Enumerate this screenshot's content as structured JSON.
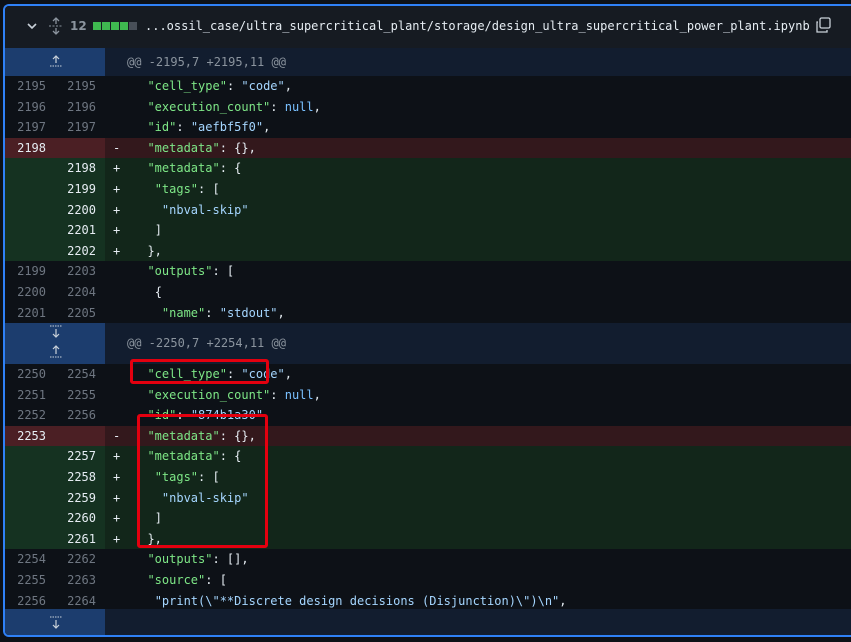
{
  "header": {
    "changes_count": "12",
    "diffstat": [
      "add",
      "add",
      "add",
      "add",
      "neutral"
    ],
    "file_path": "...ossil_case/ultra_supercritical_plant/storage/design_ultra_supercritical_power_plant.ipynb",
    "colors": {
      "add": "#3fb950",
      "neutral": "#484f58"
    }
  },
  "hunks": [
    {
      "header": "@@ -2195,7 +2195,11 @@"
    },
    {
      "header": "@@ -2250,7 +2254,11 @@"
    }
  ],
  "block1": [
    {
      "type": "ctx",
      "old": "2195",
      "new": "2195",
      "marker": "",
      "tokens": [
        [
          "k",
          "\"cell_type\""
        ],
        [
          "p",
          ": "
        ],
        [
          "s",
          "\"code\""
        ],
        [
          "p",
          ","
        ]
      ],
      "indent": "  "
    },
    {
      "type": "ctx",
      "old": "2196",
      "new": "2196",
      "marker": "",
      "tokens": [
        [
          "k",
          "\"execution_count\""
        ],
        [
          "p",
          ": "
        ],
        [
          "nl",
          "null"
        ],
        [
          "p",
          ","
        ]
      ],
      "indent": "  "
    },
    {
      "type": "ctx",
      "old": "2197",
      "new": "2197",
      "marker": "",
      "tokens": [
        [
          "k",
          "\"id\""
        ],
        [
          "p",
          ": "
        ],
        [
          "s",
          "\"aefbf5f0\""
        ],
        [
          "p",
          ","
        ]
      ],
      "indent": "  "
    },
    {
      "type": "del",
      "old": "2198",
      "new": "",
      "marker": "-",
      "tokens": [
        [
          "k",
          "\"metadata\""
        ],
        [
          "p",
          ": {},"
        ]
      ],
      "indent": "  "
    },
    {
      "type": "add",
      "old": "",
      "new": "2198",
      "marker": "+",
      "tokens": [
        [
          "k",
          "\"metadata\""
        ],
        [
          "p",
          ": {"
        ]
      ],
      "indent": "  "
    },
    {
      "type": "add",
      "old": "",
      "new": "2199",
      "marker": "+",
      "tokens": [
        [
          "k",
          "\"tags\""
        ],
        [
          "p",
          ": ["
        ]
      ],
      "indent": "   "
    },
    {
      "type": "add",
      "old": "",
      "new": "2200",
      "marker": "+",
      "tokens": [
        [
          "s",
          "\"nbval-skip\""
        ]
      ],
      "indent": "    "
    },
    {
      "type": "add",
      "old": "",
      "new": "2201",
      "marker": "+",
      "tokens": [
        [
          "p",
          "]"
        ]
      ],
      "indent": "   "
    },
    {
      "type": "add",
      "old": "",
      "new": "2202",
      "marker": "+",
      "tokens": [
        [
          "p",
          "},"
        ]
      ],
      "indent": "  "
    },
    {
      "type": "ctx",
      "old": "2199",
      "new": "2203",
      "marker": "",
      "tokens": [
        [
          "k",
          "\"outputs\""
        ],
        [
          "p",
          ": ["
        ]
      ],
      "indent": "  "
    },
    {
      "type": "ctx",
      "old": "2200",
      "new": "2204",
      "marker": "",
      "tokens": [
        [
          "p",
          "{"
        ]
      ],
      "indent": "   "
    },
    {
      "type": "ctx",
      "old": "2201",
      "new": "2205",
      "marker": "",
      "tokens": [
        [
          "k",
          "\"name\""
        ],
        [
          "p",
          ": "
        ],
        [
          "s",
          "\"stdout\""
        ],
        [
          "p",
          ","
        ]
      ],
      "indent": "    "
    }
  ],
  "block2": [
    {
      "type": "ctx",
      "old": "2250",
      "new": "2254",
      "marker": "",
      "tokens": [
        [
          "k",
          "\"cell_type\""
        ],
        [
          "p",
          ": "
        ],
        [
          "s",
          "\"code\""
        ],
        [
          "p",
          ","
        ]
      ],
      "indent": "  "
    },
    {
      "type": "ctx",
      "old": "2251",
      "new": "2255",
      "marker": "",
      "tokens": [
        [
          "k",
          "\"execution_count\""
        ],
        [
          "p",
          ": "
        ],
        [
          "nl",
          "null"
        ],
        [
          "p",
          ","
        ]
      ],
      "indent": "  "
    },
    {
      "type": "ctx",
      "old": "2252",
      "new": "2256",
      "marker": "",
      "tokens": [
        [
          "k",
          "\"id\""
        ],
        [
          "p",
          ": "
        ],
        [
          "s",
          "\"874b1a30\""
        ],
        [
          "p",
          ","
        ]
      ],
      "indent": "  "
    },
    {
      "type": "del",
      "old": "2253",
      "new": "",
      "marker": "-",
      "tokens": [
        [
          "k",
          "\"metadata\""
        ],
        [
          "p",
          ": {},"
        ]
      ],
      "indent": "  "
    },
    {
      "type": "add",
      "old": "",
      "new": "2257",
      "marker": "+",
      "tokens": [
        [
          "k",
          "\"metadata\""
        ],
        [
          "p",
          ": {"
        ]
      ],
      "indent": "  "
    },
    {
      "type": "add",
      "old": "",
      "new": "2258",
      "marker": "+",
      "tokens": [
        [
          "k",
          "\"tags\""
        ],
        [
          "p",
          ": ["
        ]
      ],
      "indent": "   "
    },
    {
      "type": "add",
      "old": "",
      "new": "2259",
      "marker": "+",
      "tokens": [
        [
          "s",
          "\"nbval-skip\""
        ]
      ],
      "indent": "    "
    },
    {
      "type": "add",
      "old": "",
      "new": "2260",
      "marker": "+",
      "tokens": [
        [
          "p",
          "]"
        ]
      ],
      "indent": "   "
    },
    {
      "type": "add",
      "old": "",
      "new": "2261",
      "marker": "+",
      "tokens": [
        [
          "p",
          "},"
        ]
      ],
      "indent": "  "
    },
    {
      "type": "ctx",
      "old": "2254",
      "new": "2262",
      "marker": "",
      "tokens": [
        [
          "k",
          "\"outputs\""
        ],
        [
          "p",
          ": [],"
        ]
      ],
      "indent": "  "
    },
    {
      "type": "ctx",
      "old": "2255",
      "new": "2263",
      "marker": "",
      "tokens": [
        [
          "k",
          "\"source\""
        ],
        [
          "p",
          ": ["
        ]
      ],
      "indent": "  "
    },
    {
      "type": "ctx",
      "old": "2256",
      "new": "2264",
      "marker": "",
      "tokens": [
        [
          "s",
          "\"print(\\\"**Discrete design decisions (Disjunction)\\\")\\n\""
        ],
        [
          "p",
          ","
        ]
      ],
      "indent": "   "
    }
  ]
}
